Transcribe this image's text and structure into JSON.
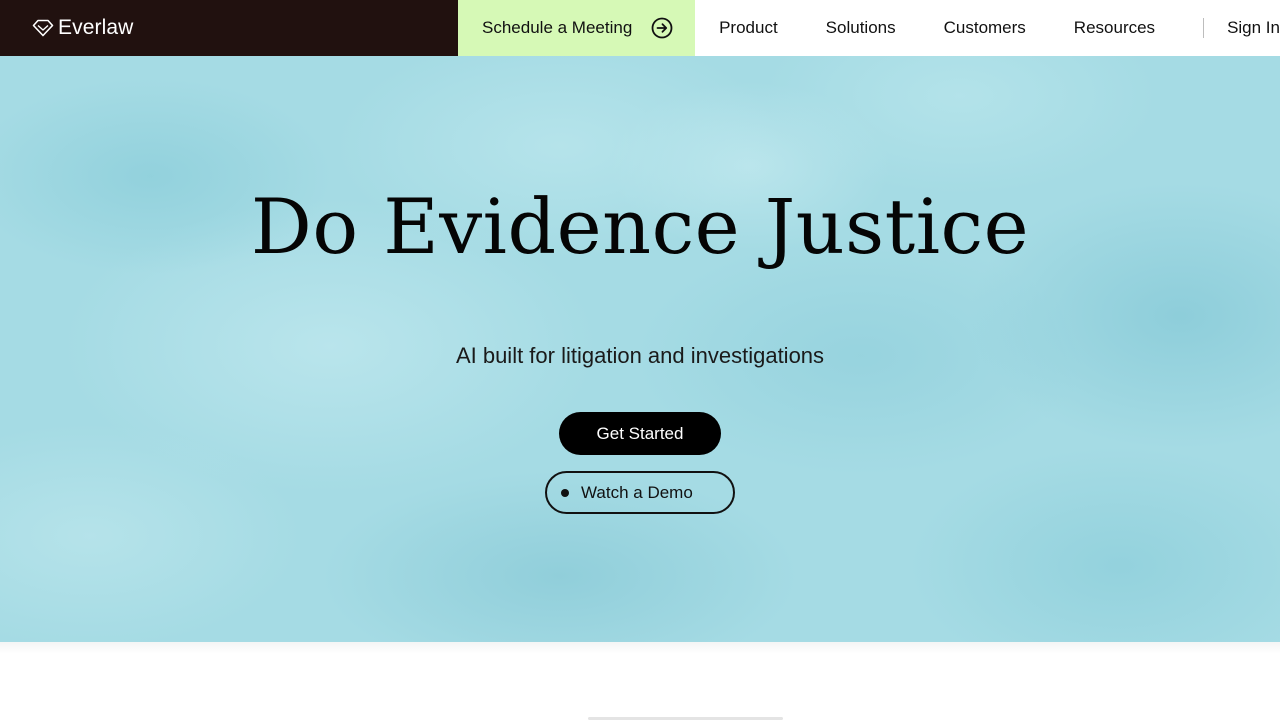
{
  "brand": {
    "name": "Everlaw",
    "icon": "diamond-logo-icon"
  },
  "nav": {
    "schedule": {
      "label": "Schedule a Meeting",
      "icon": "circle-arrow-right-icon"
    },
    "items": [
      {
        "label": "Product"
      },
      {
        "label": "Solutions"
      },
      {
        "label": "Customers"
      },
      {
        "label": "Resources"
      }
    ],
    "sign_in": "Sign In"
  },
  "hero": {
    "title": "Do Evidence Justice",
    "subtitle": "AI built for litigation and investigations",
    "primary_cta": "Get Started",
    "secondary_cta": "Watch a Demo",
    "secondary_icon": "play-dot-icon"
  },
  "colors": {
    "nav_dark": "#21110f",
    "schedule_bg": "#d6f9b6",
    "hero_bg": "#a5dbe4",
    "button_primary": "#000000"
  }
}
